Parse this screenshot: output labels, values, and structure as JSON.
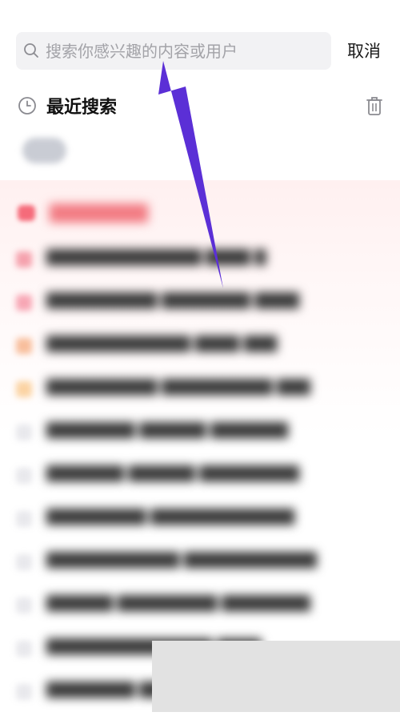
{
  "search": {
    "placeholder": "搜索你感兴趣的内容或用户",
    "value": "",
    "cancel_label": "取消"
  },
  "recent": {
    "title": "最近搜索",
    "chips": [
      ""
    ]
  },
  "hot": {
    "items": [
      {
        "rank_color": "#f5a1ad"
      },
      {
        "rank_color": "#f7a6b4"
      },
      {
        "rank_color": "#f8be9c"
      },
      {
        "rank_color": "#fbd3a3"
      },
      {
        "rank_color": "#e8e8ec"
      },
      {
        "rank_color": "#e8e8ec"
      },
      {
        "rank_color": "#e8e8ec"
      },
      {
        "rank_color": "#e8e8ec"
      },
      {
        "rank_color": "#e8e8ec"
      },
      {
        "rank_color": "#e8e8ec"
      },
      {
        "rank_color": "#e8e8ec"
      }
    ]
  },
  "colors": {
    "accent_arrow": "#5b2fd6",
    "hot_badge": "#f56b7a"
  },
  "icons": [
    "search-icon",
    "clock-icon",
    "trash-icon"
  ]
}
